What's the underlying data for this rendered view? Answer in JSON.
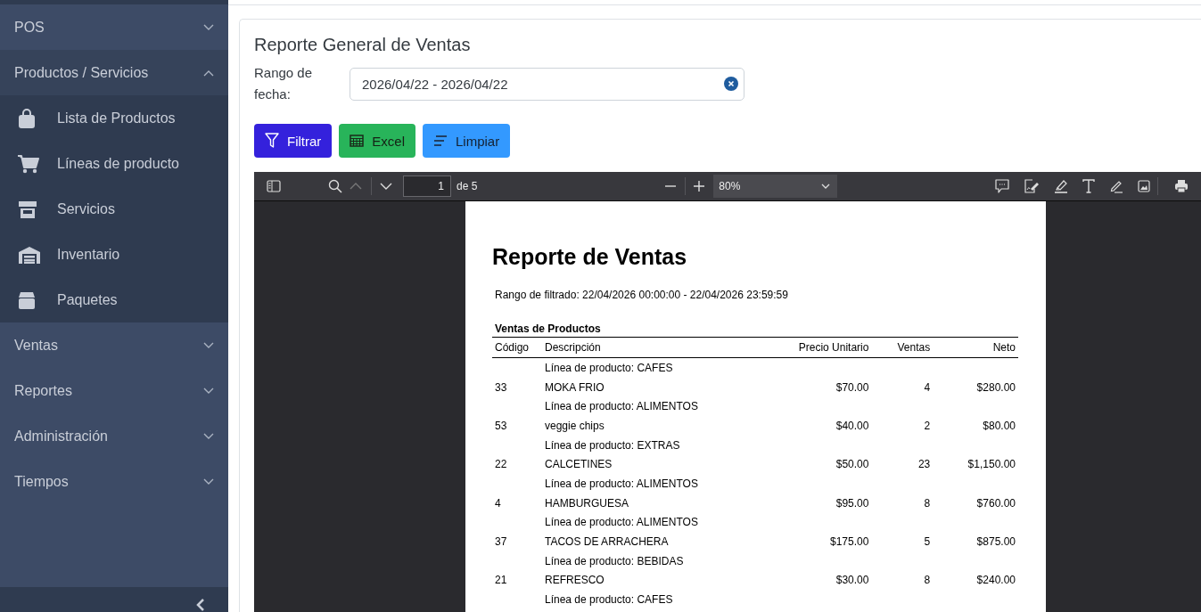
{
  "sidebar": {
    "groups": [
      {
        "label": "POS",
        "expanded": false
      },
      {
        "label": "Productos / Servicios",
        "expanded": true,
        "children": [
          {
            "label": "Lista de Productos"
          },
          {
            "label": "Líneas de producto"
          },
          {
            "label": "Servicios"
          },
          {
            "label": "Inventario"
          },
          {
            "label": "Paquetes"
          }
        ]
      },
      {
        "label": "Ventas",
        "expanded": false
      },
      {
        "label": "Reportes",
        "expanded": false
      },
      {
        "label": "Administración",
        "expanded": false
      },
      {
        "label": "Tiempos",
        "expanded": false
      }
    ]
  },
  "card": {
    "title": "Reporte General de Ventas",
    "date_label": "Rango de fecha:",
    "date_value": "2026/04/22 - 2026/04/22",
    "buttons": [
      {
        "label": "Filtrar",
        "kind": "filter"
      },
      {
        "label": "Excel",
        "kind": "excel"
      },
      {
        "label": "Limpiar",
        "kind": "clear"
      }
    ]
  },
  "pdf_viewer": {
    "page": "1",
    "page_count": "de 5",
    "zoom": "80%",
    "report": {
      "title": "Reporte de Ventas",
      "range": "Rango de filtrado: 22/04/2026 00:00:00 - 22/04/2026 23:59:59",
      "section": "Ventas de Productos",
      "columns": [
        "Código",
        "Descripción",
        "Precio Unitario",
        "Ventas",
        "Neto"
      ],
      "groups": [
        {
          "line": "Línea de producto: CAFES",
          "code": "33",
          "description": "MOKA FRIO",
          "price": "$70.00",
          "sales": "4",
          "net": "$280.00"
        },
        {
          "line": "Línea de producto: ALIMENTOS",
          "code": "53",
          "description": "veggie chips",
          "price": "$40.00",
          "sales": "2",
          "net": "$80.00"
        },
        {
          "line": "Línea de producto: EXTRAS",
          "code": "22",
          "description": "CALCETINES",
          "price": "$50.00",
          "sales": "23",
          "net": "$1,150.00"
        },
        {
          "line": "Línea de producto: ALIMENTOS",
          "code": "4",
          "description": "HAMBURGUESA",
          "price": "$95.00",
          "sales": "8",
          "net": "$760.00"
        },
        {
          "line": "Línea de producto: ALIMENTOS",
          "code": "37",
          "description": "TACOS DE ARRACHERA",
          "price": "$175.00",
          "sales": "5",
          "net": "$875.00"
        },
        {
          "line": "Línea de producto: BEBIDAS",
          "code": "21",
          "description": "REFRESCO",
          "price": "$30.00",
          "sales": "8",
          "net": "$240.00"
        },
        {
          "line": "Línea de producto: CAFES"
        }
      ]
    }
  }
}
